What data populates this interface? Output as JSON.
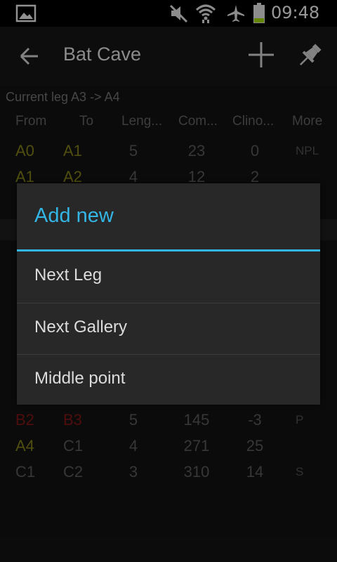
{
  "status_bar": {
    "time": "09:48"
  },
  "action_bar": {
    "title": "Bat Cave"
  },
  "content": {
    "current_leg": "Current leg A3 -> A4",
    "headers": [
      "From",
      "To",
      "Leng...",
      "Com...",
      "Clino...",
      "More"
    ],
    "rows": [
      {
        "from": "A0",
        "to": "A1",
        "length": "5",
        "compass": "23",
        "clino": "0",
        "more": "NPL",
        "from_color": "yellow",
        "to_color": "yellow"
      },
      {
        "from": "A1",
        "to": "A2",
        "length": "4",
        "compass": "12",
        "clino": "2",
        "more": "",
        "from_color": "yellow",
        "to_color": "yellow"
      },
      {
        "from": "B2",
        "to": "B3",
        "length": "5",
        "compass": "145",
        "clino": "-3",
        "more": "P",
        "from_color": "red",
        "to_color": "red"
      },
      {
        "from": "A4",
        "to": "C1",
        "length": "4",
        "compass": "271",
        "clino": "25",
        "more": "",
        "from_color": "yellow",
        "to_color": "dim"
      },
      {
        "from": "C1",
        "to": "C2",
        "length": "3",
        "compass": "310",
        "clino": "14",
        "more": "S",
        "from_color": "dim",
        "to_color": "dim"
      }
    ]
  },
  "dialog": {
    "title": "Add new",
    "items": [
      "Next Leg",
      "Next Gallery",
      "Middle point"
    ]
  },
  "colors": {
    "accent": "#33b5e5",
    "yellow_station": "#7b7a18",
    "red_station": "#7a1515"
  },
  "icons": [
    "gallery-icon",
    "mute-icon",
    "wifi-icon",
    "airplane-icon",
    "battery-icon",
    "back-arrow-icon",
    "plus-icon",
    "pin-icon"
  ]
}
